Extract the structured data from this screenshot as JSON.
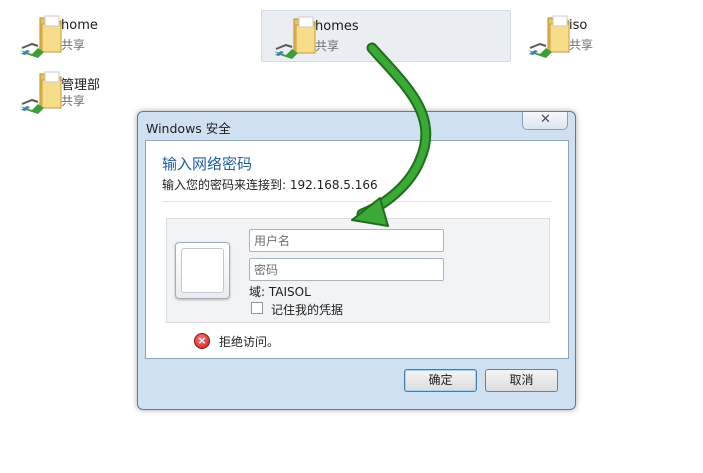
{
  "shares": [
    {
      "name": "home",
      "type": "共享",
      "icon": "shared-folder-icon"
    },
    {
      "name": "homes",
      "type": "共享",
      "icon": "shared-folder-icon"
    },
    {
      "name": "iso",
      "type": "共享",
      "icon": "shared-folder-icon"
    },
    {
      "name": "管理部",
      "type": "共享",
      "icon": "shared-folder-icon"
    }
  ],
  "dialog": {
    "title": "Windows 安全",
    "close_glyph": "✕",
    "heading": "输入网络密码",
    "subheading": "输入您的密码来连接到: 192.168.5.166",
    "username_placeholder": "用户名",
    "password_placeholder": "密码",
    "domain": "域: TAISOL",
    "remember_label": "记住我的凭据",
    "remember_checked": false,
    "error_text": "拒绝访问。",
    "error_icon": "error-x-icon",
    "ok_label": "确定",
    "cancel_label": "取消"
  },
  "colors": {
    "heading": "#1f5ea4",
    "dialog_frame": "#cfe0f1",
    "annotation_arrow": "#2e9a2a"
  }
}
